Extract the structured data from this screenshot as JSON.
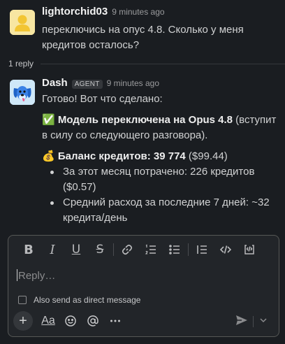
{
  "messages": [
    {
      "author": "lightorchid03",
      "time": "9 minutes ago",
      "text": "переключись на опус 4.8. Сколько у меня кредитов осталось?"
    },
    {
      "author": "Dash",
      "badge": "AGENT",
      "time": "9 minutes ago",
      "line1": "Готово! Вот что сделано:",
      "check_emoji": "✅",
      "model_bold": "Модель переключена на Opus 4.8",
      "model_rest": " (вступит в силу со следующего разговора).",
      "bag_emoji": "💰",
      "balance_bold": "Баланс кредитов: 39 774",
      "balance_rest": " ($99.44)",
      "bullets": [
        "За этот месяц потрачено: 226 кредитов ($0.57)",
        "Средний расход за последние 7 дней: ~32 кредита/день"
      ]
    }
  ],
  "reply_count": "1 reply",
  "composer": {
    "placeholder": "Reply…",
    "checkbox_label": "Also send as direct message",
    "format_label": "Aa"
  }
}
